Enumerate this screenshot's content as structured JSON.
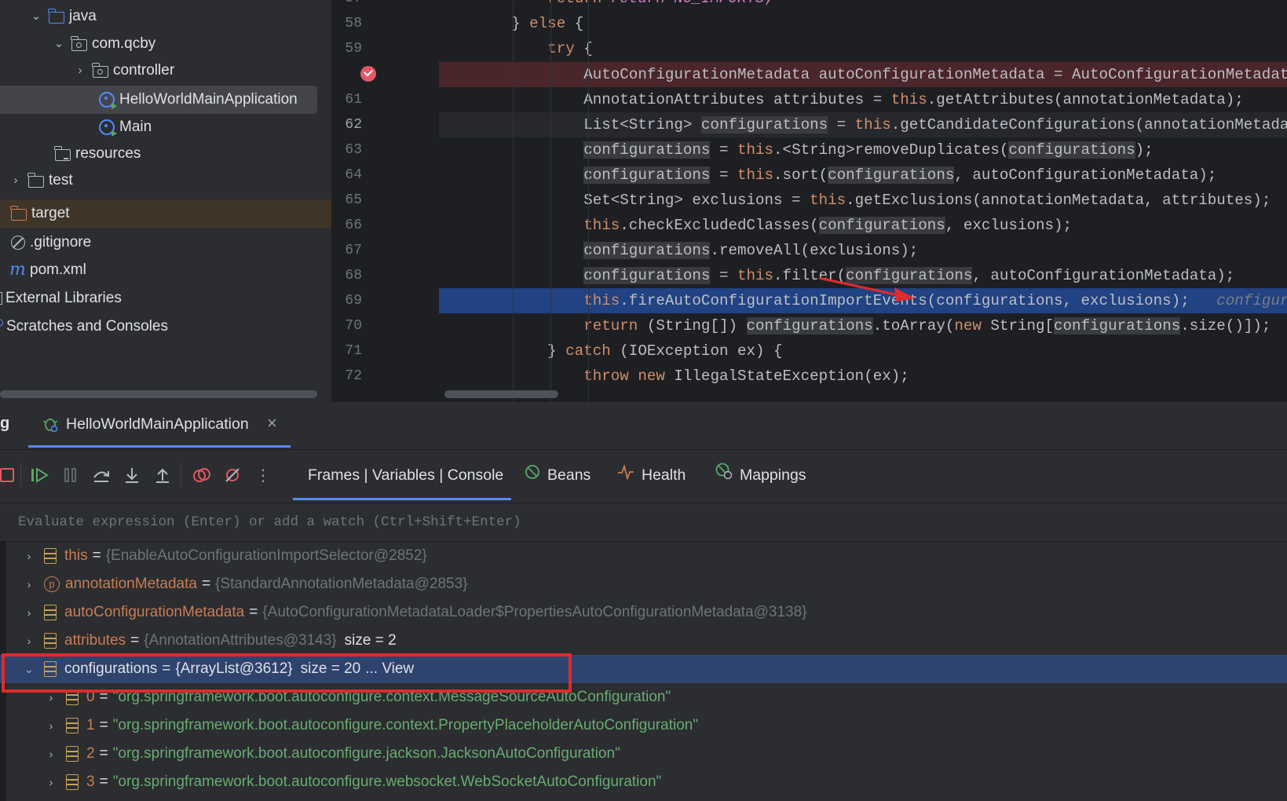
{
  "tree": {
    "items": [
      {
        "label": "java",
        "type": "folder-blue",
        "chevron": "expanded"
      },
      {
        "label": "com.qcby",
        "type": "package",
        "chevron": "expanded"
      },
      {
        "label": "controller",
        "type": "package",
        "chevron": "collapsed"
      },
      {
        "label": "HelloWorldMainApplication",
        "type": "spring-class",
        "selected": true
      },
      {
        "label": "Main",
        "type": "spring-class"
      },
      {
        "label": "resources",
        "type": "resources-folder"
      },
      {
        "label": "test",
        "type": "folder",
        "chevron": "collapsed"
      },
      {
        "label": "target",
        "type": "folder-orange",
        "highlighted": true
      },
      {
        "label": ".gitignore",
        "type": "gitignore"
      },
      {
        "label": "pom.xml",
        "type": "maven",
        "icon_text": "m"
      },
      {
        "label": "External Libraries",
        "type": "library"
      },
      {
        "label": "Scratches and Consoles",
        "type": "scratch"
      }
    ]
  },
  "editor": {
    "line_numbers": [
      "58",
      "59",
      "",
      "61",
      "62",
      "63",
      "64",
      "65",
      "66",
      "67",
      "68",
      "69",
      "70",
      "71",
      "72"
    ],
    "top_partial": "return NO_IMPORTS;",
    "breakpoint_line": "60",
    "current_line": "62",
    "execution_line": "69"
  },
  "debug": {
    "panel_label": "g",
    "session_tab": "HelloWorldMainApplication",
    "close_symbol": "×",
    "subtabs": {
      "frames": "Frames | Variables | Console",
      "beans": "Beans",
      "health": "Health",
      "mappings": "Mappings"
    },
    "toolbar": {
      "stop": "stop-icon",
      "resume": "resume-icon",
      "pause": "pause-icon",
      "step_over": "step-over-icon",
      "step_into": "step-into-icon",
      "step_out": "step-out-icon",
      "view_breakpoints": "view-breakpoints-icon",
      "mute_breakpoints": "mute-breakpoints-icon",
      "more": "⋮"
    },
    "eval_placeholder": "Evaluate expression (Enter) or add a watch (Ctrl+Shift+Enter)",
    "variables": [
      {
        "name": "this",
        "value": "{EnableAutoConfigurationImportSelector@2852}",
        "icon": "field"
      },
      {
        "name": "annotationMetadata",
        "value": "{StandardAnnotationMetadata@2853}",
        "icon": "param",
        "icon_text": "p"
      },
      {
        "name": "autoConfigurationMetadata",
        "value": "{AutoConfigurationMetadataLoader$PropertiesAutoConfigurationMetadata@3138}",
        "icon": "field"
      },
      {
        "name": "attributes",
        "value": "{AnnotationAttributes@3143}",
        "size": "size = 2",
        "icon": "field"
      },
      {
        "name": "configurations",
        "value": "{ArrayList@3612}",
        "size": "size = 20",
        "view": "... View",
        "icon": "field",
        "expanded": true,
        "selected": true
      }
    ],
    "config_items": [
      {
        "index": "0",
        "value": "\"org.springframework.boot.autoconfigure.context.MessageSourceAutoConfiguration\""
      },
      {
        "index": "1",
        "value": "\"org.springframework.boot.autoconfigure.context.PropertyPlaceholderAutoConfiguration\""
      },
      {
        "index": "2",
        "value": "\"org.springframework.boot.autoconfigure.jackson.JacksonAutoConfiguration\""
      },
      {
        "index": "3",
        "value": "\"org.springframework.boot.autoconfigure.websocket.WebSocketAutoConfiguration\""
      }
    ]
  },
  "colors": {
    "keyword": "#cf8e6d",
    "string": "#6aab73",
    "selection": "#2e436e",
    "execution": "#214283",
    "breakpoint": "#e55765",
    "annotation_red": "#e02b2b"
  }
}
